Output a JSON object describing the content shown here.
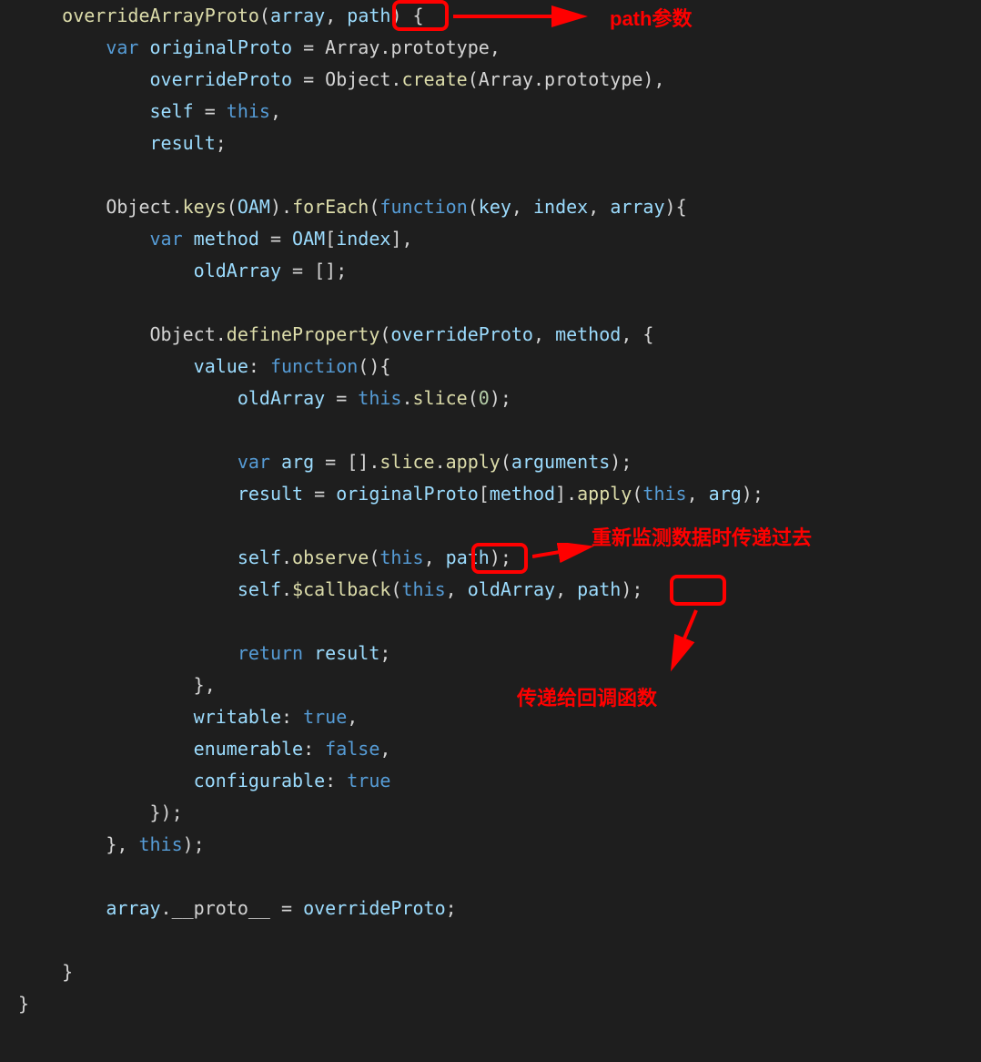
{
  "code": {
    "l1_fn": "overrideArrayProto",
    "l1_p1": "array",
    "l1_p2": "path",
    "l2_var": "var",
    "l2_v1": "originalProto",
    "l2_v2": "Array",
    "l2_v3": "prototype",
    "l3_v1": "overrideProto",
    "l3_v2": "Object",
    "l3_m": "create",
    "l3_v3": "Array",
    "l3_v4": "prototype",
    "l4_v1": "self",
    "l4_this": "this",
    "l5_v1": "result",
    "l7_v1": "Object",
    "l7_m1": "keys",
    "l7_v2": "OAM",
    "l7_m2": "forEach",
    "l7_fn": "function",
    "l7_p1": "key",
    "l7_p2": "index",
    "l7_p3": "array",
    "l8_var": "var",
    "l8_v1": "method",
    "l8_v2": "OAM",
    "l8_v3": "index",
    "l9_v1": "oldArray",
    "l11_v1": "Object",
    "l11_m1": "defineProperty",
    "l11_v2": "overrideProto",
    "l11_v3": "method",
    "l12_k": "value",
    "l12_fn": "function",
    "l13_v1": "oldArray",
    "l13_this": "this",
    "l13_m": "slice",
    "l13_n": "0",
    "l15_var": "var",
    "l15_v1": "arg",
    "l15_m1": "slice",
    "l15_m2": "apply",
    "l15_v2": "arguments",
    "l16_v1": "result",
    "l16_v2": "originalProto",
    "l16_v3": "method",
    "l16_m": "apply",
    "l16_this": "this",
    "l16_v4": "arg",
    "l18_v1": "self",
    "l18_m": "observe",
    "l18_this": "this",
    "l18_v2": "path",
    "l19_v1": "self",
    "l19_m": "$callback",
    "l19_this": "this",
    "l19_v2": "oldArray",
    "l19_v3": "path",
    "l21_return": "return",
    "l21_v": "result",
    "l23_k": "writable",
    "l23_b": "true",
    "l24_k": "enumerable",
    "l24_b": "false",
    "l25_k": "configurable",
    "l25_b": "true",
    "l27_this": "this",
    "l29_v1": "array",
    "l29_v2": "__proto__",
    "l29_v3": "overrideProto"
  },
  "annotations": {
    "a1": "path参数",
    "a2": "重新监测数据时传递过去",
    "a3": "传递给回调函数"
  }
}
